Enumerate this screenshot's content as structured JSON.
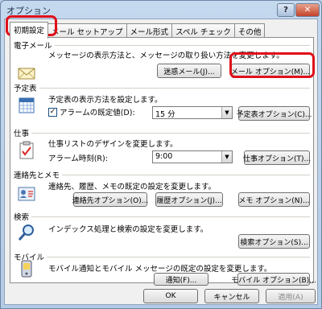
{
  "window": {
    "title": "オプション",
    "help_label": "?",
    "close_label": "✕"
  },
  "tabs": [
    {
      "label": "初期設定",
      "active": true
    },
    {
      "label": "メール セットアップ"
    },
    {
      "label": "メール形式"
    },
    {
      "label": "スペル チェック"
    },
    {
      "label": "その他"
    }
  ],
  "sections": {
    "mail": {
      "title": "電子メール",
      "description": "メッセージの表示方法と、メッセージの取り扱い方法を変更します。",
      "junk_button": "迷惑メール(J)...",
      "options_button": "メール オプション(M)...",
      "icon": "envelope-icon"
    },
    "calendar": {
      "title": "予定表",
      "description": "予定表の表示方法を設定します。",
      "reminder_label": "アラームの既定値(D):",
      "reminder_checked": true,
      "reminder_value": "15 分",
      "options_button": "予定表オプション(C)...",
      "icon": "calendar-icon"
    },
    "tasks": {
      "title": "仕事",
      "description": "仕事リストのデザインを変更します。",
      "reminder_time_label": "アラーム時刻(R):",
      "reminder_time_value": "9:00",
      "options_button": "仕事オプション(T)...",
      "icon": "task-clipboard-icon"
    },
    "contacts": {
      "title": "連絡先とメモ",
      "description": "連絡先、履歴、メモの既定の設定を変更します。",
      "contact_button": "連絡先オプション(O)...",
      "journal_button": "履歴オプション(J)...",
      "notes_button": "メモ オプション(N)...",
      "icon": "contact-card-icon"
    },
    "search": {
      "title": "検索",
      "description": "インデックス処理と検索の設定を変更します。",
      "options_button": "検索オプション(S)...",
      "icon": "magnifier-icon"
    },
    "mobile": {
      "title": "モバイル",
      "description": "モバイル通知とモバイル メッセージの既定の設定を変更します。",
      "notify_button": "通知(F)...",
      "options_button": "モバイル オプション(B)...",
      "icon": "mobile-phone-icon"
    }
  },
  "footer": {
    "ok": "OK",
    "cancel": "キャンセル",
    "apply": "適用(A)"
  },
  "highlight_color": "#e0101a"
}
